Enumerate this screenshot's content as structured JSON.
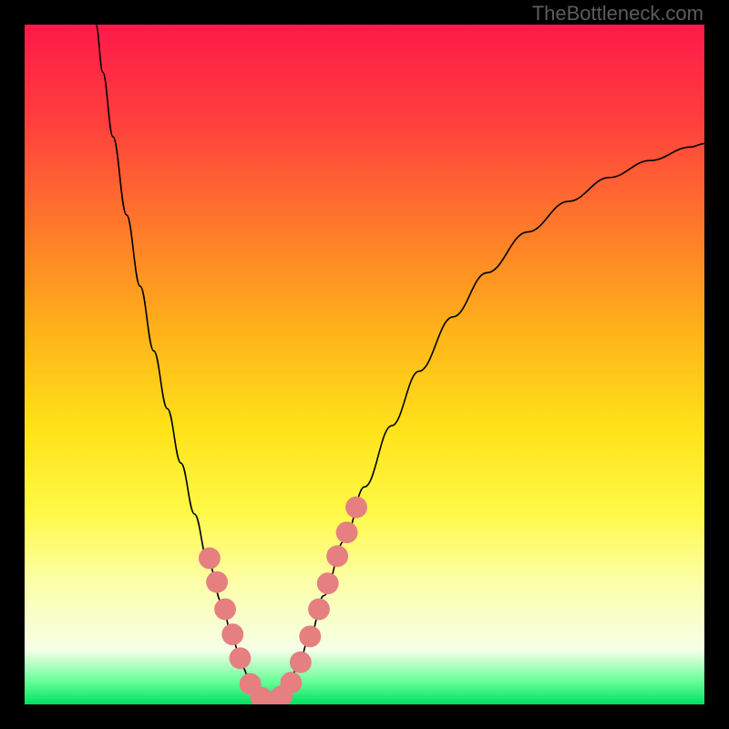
{
  "watermark": "TheBottleneck.com",
  "chart_data": {
    "type": "line",
    "title": "",
    "xlabel": "",
    "ylabel": "",
    "xlim": [
      0,
      100
    ],
    "ylim": [
      0,
      100
    ],
    "gradient_stops": [
      {
        "offset": 0.0,
        "color": "#ff1a4a"
      },
      {
        "offset": 0.14,
        "color": "#ff3e3e"
      },
      {
        "offset": 0.3,
        "color": "#ff7a2a"
      },
      {
        "offset": 0.45,
        "color": "#ffb21a"
      },
      {
        "offset": 0.6,
        "color": "#ffe41a"
      },
      {
        "offset": 0.72,
        "color": "#fff94a"
      },
      {
        "offset": 0.82,
        "color": "#fcffa8"
      },
      {
        "offset": 0.92,
        "color": "#f6ffe8"
      },
      {
        "offset": 0.965,
        "color": "#6cff9a"
      },
      {
        "offset": 1.0,
        "color": "#00e060"
      }
    ],
    "curve_points": [
      {
        "x": 10.5,
        "y": 100.0
      },
      {
        "x": 11.5,
        "y": 93.0
      },
      {
        "x": 13.0,
        "y": 83.5
      },
      {
        "x": 15.0,
        "y": 72.0
      },
      {
        "x": 17.0,
        "y": 61.5
      },
      {
        "x": 19.0,
        "y": 52.0
      },
      {
        "x": 21.0,
        "y": 43.5
      },
      {
        "x": 23.0,
        "y": 35.5
      },
      {
        "x": 25.0,
        "y": 28.0
      },
      {
        "x": 27.0,
        "y": 21.0
      },
      {
        "x": 29.0,
        "y": 15.0
      },
      {
        "x": 30.5,
        "y": 10.0
      },
      {
        "x": 32.0,
        "y": 5.5
      },
      {
        "x": 33.5,
        "y": 2.5
      },
      {
        "x": 35.0,
        "y": 0.8
      },
      {
        "x": 36.5,
        "y": 0.3
      },
      {
        "x": 38.0,
        "y": 1.5
      },
      {
        "x": 40.0,
        "y": 5.0
      },
      {
        "x": 42.0,
        "y": 10.0
      },
      {
        "x": 44.0,
        "y": 16.0
      },
      {
        "x": 47.0,
        "y": 24.0
      },
      {
        "x": 50.0,
        "y": 32.0
      },
      {
        "x": 54.0,
        "y": 41.0
      },
      {
        "x": 58.0,
        "y": 49.0
      },
      {
        "x": 63.0,
        "y": 57.0
      },
      {
        "x": 68.0,
        "y": 63.5
      },
      {
        "x": 74.0,
        "y": 69.5
      },
      {
        "x": 80.0,
        "y": 74.0
      },
      {
        "x": 86.0,
        "y": 77.5
      },
      {
        "x": 92.0,
        "y": 80.0
      },
      {
        "x": 98.0,
        "y": 82.0
      },
      {
        "x": 100.0,
        "y": 82.5
      }
    ],
    "marker_points": [
      {
        "x": 27.2,
        "y": 21.5
      },
      {
        "x": 28.3,
        "y": 18.0
      },
      {
        "x": 29.5,
        "y": 14.0
      },
      {
        "x": 30.6,
        "y": 10.3
      },
      {
        "x": 31.7,
        "y": 6.8
      },
      {
        "x": 33.2,
        "y": 3.0
      },
      {
        "x": 34.8,
        "y": 1.0
      },
      {
        "x": 36.4,
        "y": 0.4
      },
      {
        "x": 37.8,
        "y": 1.2
      },
      {
        "x": 39.2,
        "y": 3.2
      },
      {
        "x": 40.6,
        "y": 6.2
      },
      {
        "x": 42.0,
        "y": 10.0
      },
      {
        "x": 43.3,
        "y": 14.0
      },
      {
        "x": 44.6,
        "y": 17.8
      },
      {
        "x": 46.0,
        "y": 21.8
      },
      {
        "x": 47.4,
        "y": 25.3
      },
      {
        "x": 48.8,
        "y": 29.0
      }
    ],
    "marker_color": "#e57f80",
    "marker_radius_pct": 1.6,
    "curve_stroke": "#000000",
    "curve_width": 1.6
  }
}
